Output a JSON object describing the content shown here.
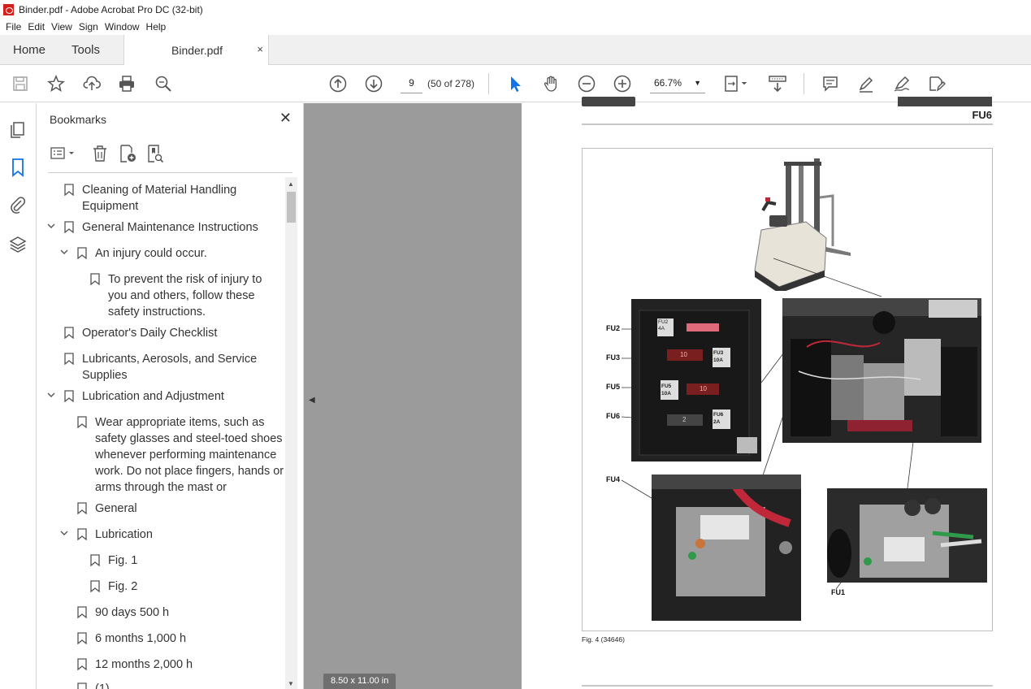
{
  "window": {
    "title": "Binder.pdf - Adobe Acrobat Pro DC (32-bit)"
  },
  "menu": {
    "items": [
      "File",
      "Edit",
      "View",
      "Sign",
      "Window",
      "Help"
    ]
  },
  "tabs": {
    "home": "Home",
    "tools": "Tools",
    "document": "Binder.pdf",
    "close": "×"
  },
  "toolbar": {
    "page_number": "9",
    "page_count": "(50 of 278)",
    "zoom": "66.7%"
  },
  "bookmarks": {
    "title": "Bookmarks",
    "items": [
      {
        "text": "Cleaning of Material Handling Equipment",
        "level": 0,
        "expanded": null
      },
      {
        "text": "General Maintenance Instructions",
        "level": 0,
        "expanded": true
      },
      {
        "text": "An injury could occur.",
        "level": 1,
        "expanded": true
      },
      {
        "text": "To prevent the risk of injury to you and others, follow these safety instructions.",
        "level": 2,
        "expanded": null
      },
      {
        "text": "Operator's Daily Checklist",
        "level": 0,
        "expanded": null
      },
      {
        "text": "Lubricants, Aerosols, and Service Supplies",
        "level": 0,
        "expanded": null
      },
      {
        "text": "Lubrication and Adjustment",
        "level": 0,
        "expanded": true
      },
      {
        "text": "Wear appropriate items, such as safety glasses and steel-toed shoes whenever performing maintenance work. Do not place fingers, hands or arms through the mast or",
        "level": 1,
        "expanded": null
      },
      {
        "text": "General",
        "level": 1,
        "expanded": null
      },
      {
        "text": "Lubrication",
        "level": 1,
        "expanded": true
      },
      {
        "text": "Fig. 1",
        "level": 2,
        "expanded": null
      },
      {
        "text": "Fig. 2",
        "level": 2,
        "expanded": null
      },
      {
        "text": "90 days 500 h",
        "level": 1,
        "expanded": null
      },
      {
        "text": "6 months 1,000 h",
        "level": 1,
        "expanded": null
      },
      {
        "text": "12 months 2,000 h",
        "level": 1,
        "expanded": null
      },
      {
        "text": "(1)",
        "level": 1,
        "expanded": null
      }
    ]
  },
  "document": {
    "header_code": "FU6",
    "fuse_labels": [
      "FU2",
      "FU3",
      "FU5",
      "FU6",
      "FU4",
      "FU1"
    ],
    "fuse_panel": {
      "fu2": "FU2\n4A",
      "fu3": "FU3\n10A",
      "fu5": "FU5\n10A",
      "fu6": "FU6\n2A",
      "blade_10a_1": "10",
      "blade_10a_2": "10",
      "blade_2a": "2"
    },
    "figure_caption": "Fig. 4 (34646)",
    "page_size": "8.50 x 11.00 in"
  },
  "colors": {
    "accent_blue": "#1473e6",
    "viewer_gray": "#9b9b9b",
    "fuse_red": "#c0283a"
  }
}
